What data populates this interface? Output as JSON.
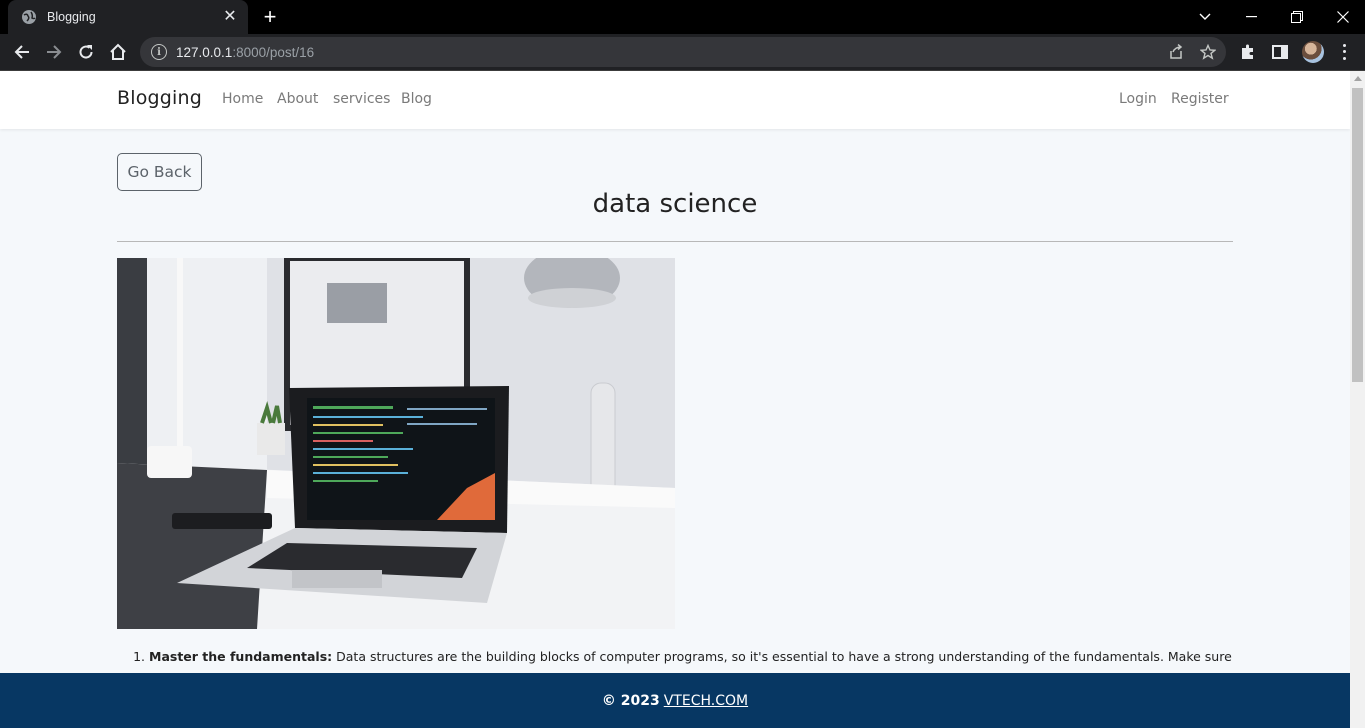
{
  "browser": {
    "tab_title": "Blogging",
    "url_host": "127.0.0.1",
    "url_path": ":8000/post/16"
  },
  "navbar": {
    "brand": "Blogging",
    "links": [
      "Home",
      "About",
      "services",
      "Blog"
    ],
    "auth": [
      "Login",
      "Register"
    ]
  },
  "post": {
    "back_label": "Go Back",
    "title": "data science",
    "image_alt": "laptop-desk-photo",
    "list": [
      {
        "heading": "Master the fundamentals:",
        "text": " Data structures are the building blocks of computer programs, so it's essential to have a strong understanding of the fundamentals. Make sure"
      }
    ]
  },
  "footer": {
    "copyright": "© 2023",
    "site": "VTECH.COM"
  },
  "colors": {
    "footer_bg": "#073763",
    "page_bg": "#f5f8fb",
    "browser_bg": "#202124"
  }
}
